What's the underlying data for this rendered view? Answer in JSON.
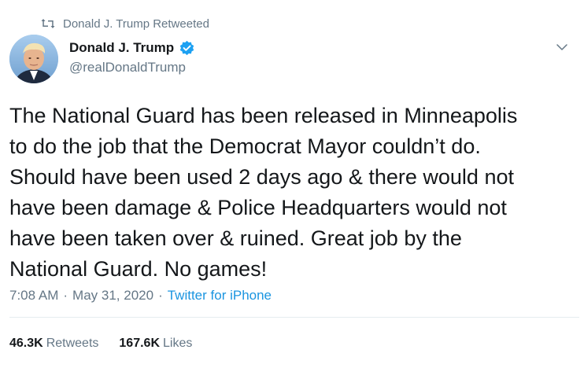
{
  "retweet_context": {
    "icon": "retweet-icon",
    "text": "Donald J. Trump Retweeted"
  },
  "author": {
    "display_name": "Donald J. Trump",
    "handle": "@realDonaldTrump",
    "verified": true,
    "verified_icon": "verified-badge-icon"
  },
  "menu": {
    "icon": "chevron-down-icon"
  },
  "tweet": {
    "text": "The National Guard has been released in Minneapolis\nto do the job that the Democrat Mayor couldn’t do.\nShould have been used 2 days ago & there would not\nhave been damage & Police Headquarters would not\nhave been taken over & ruined. Great job by the\nNational Guard. No games!",
    "time": "7:08 AM",
    "separator": "·",
    "date": "May 31, 2020",
    "source": "Twitter for iPhone"
  },
  "stats": {
    "retweets_count": "46.3K",
    "retweets_label": "Retweets",
    "likes_count": "167.6K",
    "likes_label": "Likes"
  },
  "colors": {
    "secondary_text": "#657786",
    "link": "#1b95e0",
    "verified": "#1da1f2",
    "divider": "#e6ecf0"
  }
}
